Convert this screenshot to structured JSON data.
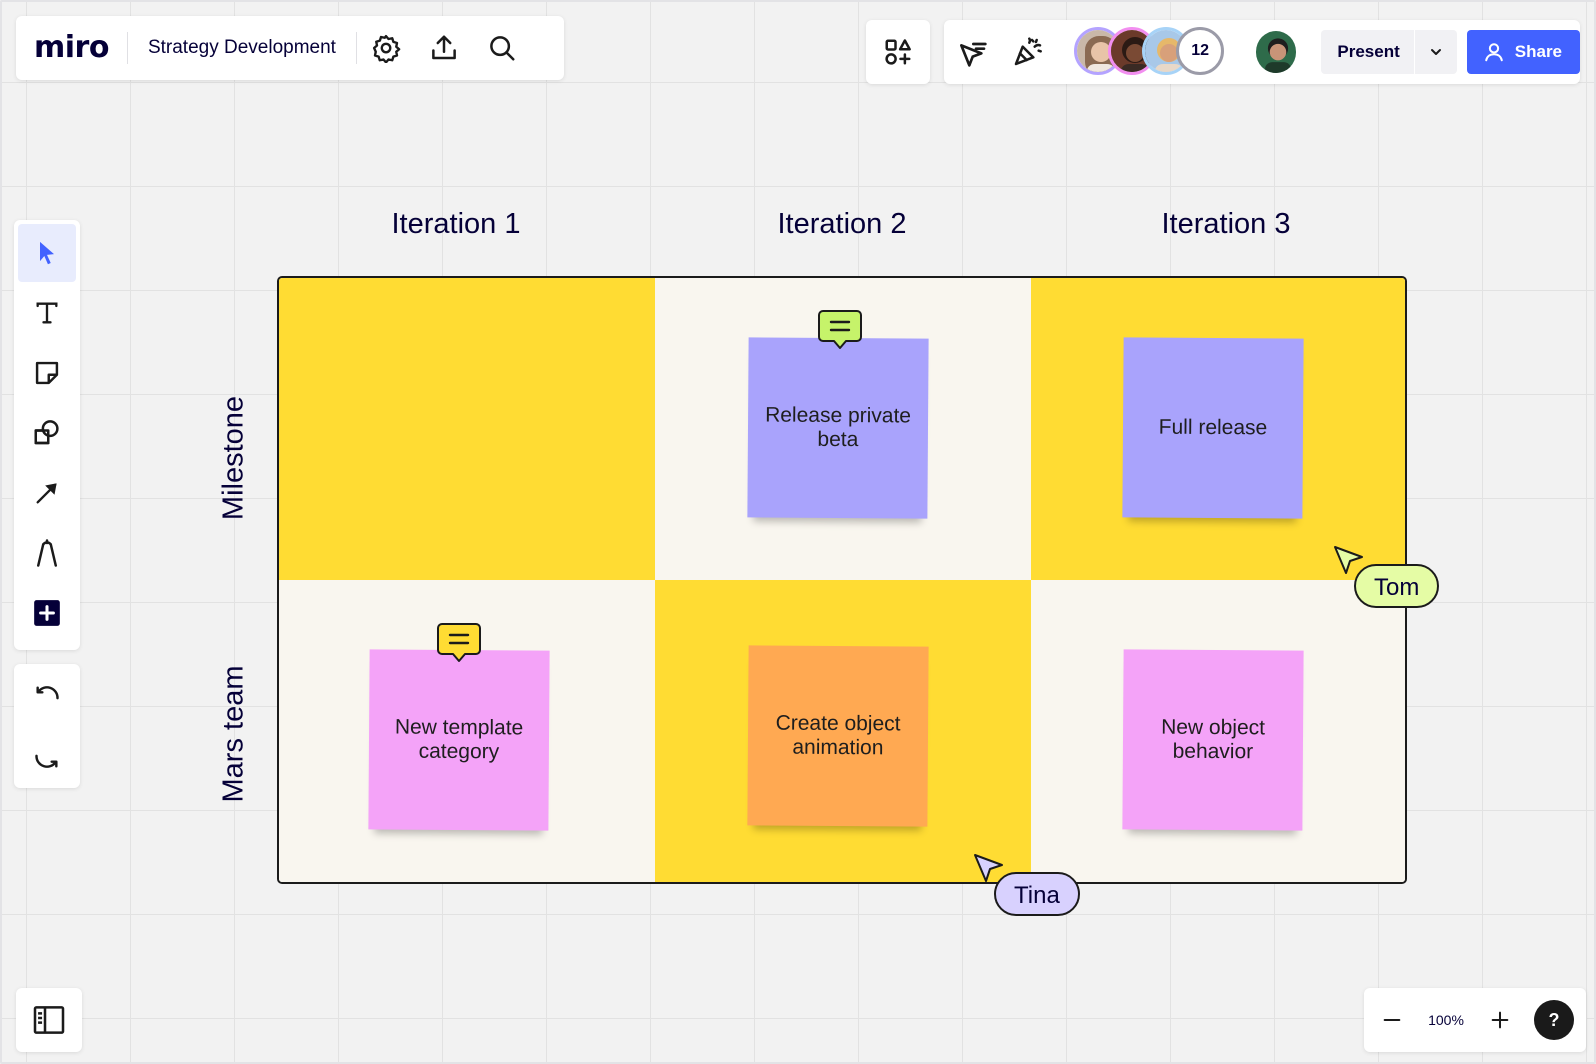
{
  "app": {
    "logo": "miro",
    "board_title": "Strategy Development"
  },
  "top_bar": {
    "settings_icon": "gear-icon",
    "upload_icon": "upload-icon",
    "search_icon": "search-icon",
    "apps_icon": "apps-icon"
  },
  "collab": {
    "collaborators_extra_count": "12",
    "present_label": "Present",
    "share_label": "Share"
  },
  "toolbar": {
    "items": [
      "select",
      "text",
      "sticky-note",
      "shapes",
      "connection-line",
      "pen",
      "more-tools"
    ],
    "undo": "undo",
    "redo": "redo"
  },
  "zoom": {
    "level": "100%",
    "help_label": "?"
  },
  "board": {
    "columns": [
      "Iteration 1",
      "Iteration 2",
      "Iteration 3"
    ],
    "rows": [
      "Milestone",
      "Mars team"
    ],
    "stickies": {
      "release_private_beta": "Release private beta",
      "full_release": "Full release",
      "new_template_category": "New template category",
      "create_object_animation": "Create object animation",
      "new_object_behavior": "New object behavior"
    },
    "cursors": {
      "tom": "Tom",
      "tina": "Tina"
    }
  },
  "colors": {
    "accent_blue": "#4262ff",
    "ink": "#050038",
    "cell_yellow": "#ffdc33",
    "cell_cream": "#f9f6ef",
    "sticky_violet": "#a9a3fc",
    "sticky_pink": "#f4a3f8",
    "sticky_orange": "#ffa952",
    "tom_label": "#e5fca5",
    "tina_label": "#d8d1fe",
    "comment_green": "#c6f36a",
    "comment_yellow": "#ffdc33"
  }
}
